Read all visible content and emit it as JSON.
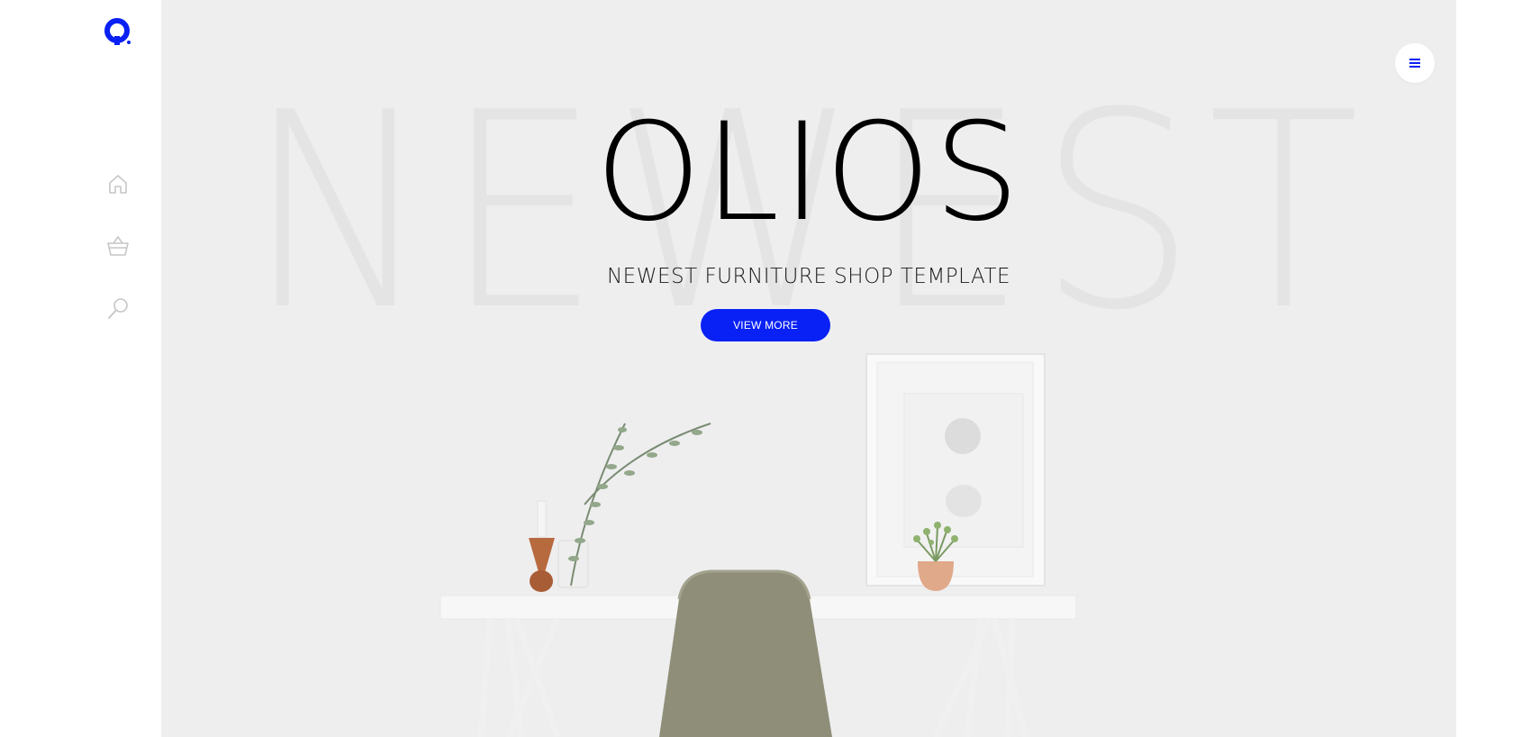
{
  "colors": {
    "accent": "#0a21f5",
    "background": "#eeeeef",
    "sidebar": "#ffffff"
  },
  "sidebar": {
    "logo": "olios-logo",
    "items": [
      {
        "name": "home",
        "icon": "home-icon"
      },
      {
        "name": "cart",
        "icon": "basket-icon"
      },
      {
        "name": "search",
        "icon": "search-icon"
      }
    ]
  },
  "hero": {
    "background_word": "NEWEST",
    "title": "OLIOS",
    "subtitle": "NEWEST FURNITURE SHOP TEMPLATE",
    "cta_label": "VIEW MORE"
  },
  "header": {
    "menu_icon": "hamburger-icon"
  }
}
